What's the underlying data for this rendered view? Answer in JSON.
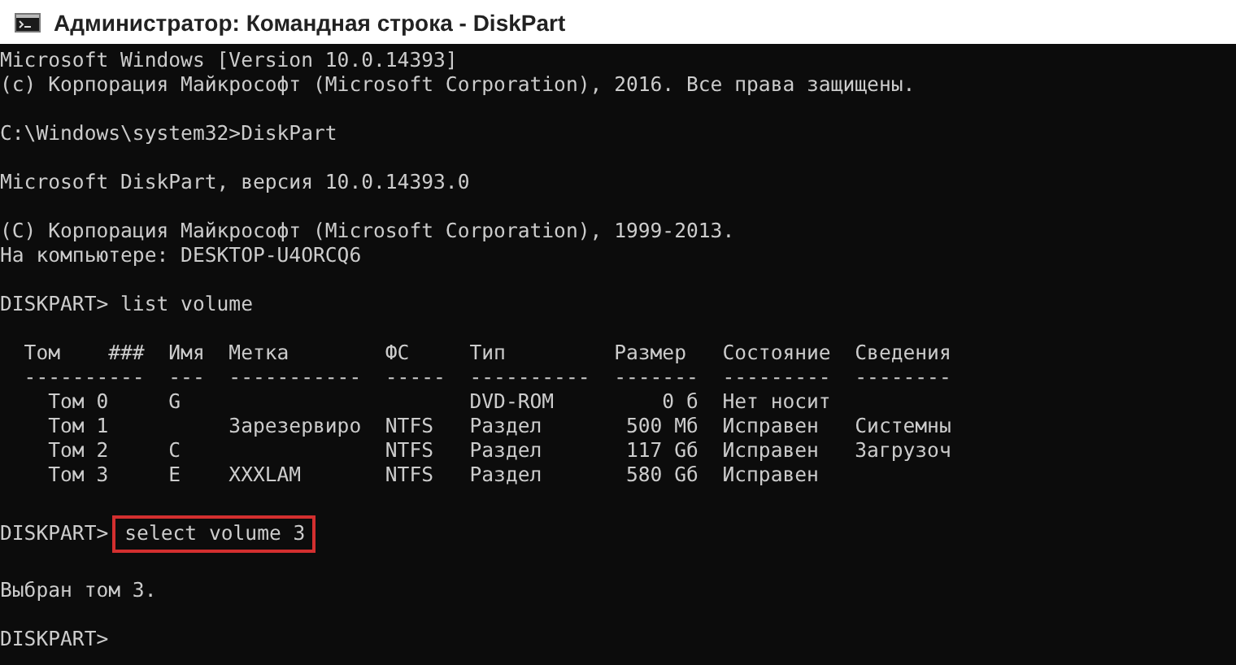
{
  "window": {
    "title": "Администратор: Командная строка - DiskPart"
  },
  "console": {
    "lines": [
      {
        "kind": "output",
        "text": "Microsoft Windows [Version 10.0.14393]"
      },
      {
        "kind": "output",
        "text": "(c) Корпорация Майкрософт (Microsoft Corporation), 2016. Все права защищены."
      },
      {
        "kind": "blank"
      },
      {
        "kind": "output",
        "text": "C:\\Windows\\system32>DiskPart"
      },
      {
        "kind": "blank"
      },
      {
        "kind": "output",
        "text": "Microsoft DiskPart, версия 10.0.14393.0"
      },
      {
        "kind": "blank"
      },
      {
        "kind": "output",
        "text": "(C) Корпорация Майкрософт (Microsoft Corporation), 1999-2013."
      },
      {
        "kind": "output",
        "text": "На компьютере: DESKTOP-U4ORCQ6"
      },
      {
        "kind": "blank"
      },
      {
        "kind": "output",
        "text": "DISKPART> list volume"
      },
      {
        "kind": "blank"
      },
      {
        "kind": "output",
        "text": "  Том    ###  Имя  Метка        ФС     Тип         Размер   Состояние  Сведения"
      },
      {
        "kind": "output",
        "text": "  ----------  ---  -----------  -----  ----------  -------  ---------  --------"
      },
      {
        "kind": "output",
        "text": "    Том 0     G                        DVD-ROM         0 б  Нет носит"
      },
      {
        "kind": "output",
        "text": "    Том 1          Зарезервиро  NTFS   Раздел       500 Мб  Исправен   Системны"
      },
      {
        "kind": "output",
        "text": "    Том 2     C                 NTFS   Раздел       117 Gб  Исправен   Загрузоч"
      },
      {
        "kind": "output",
        "text": "    Том 3     E    XXXLAM       NTFS   Раздел       580 Gб  Исправен"
      },
      {
        "kind": "blank"
      },
      {
        "kind": "command",
        "prompt": "DISKPART>",
        "command": "select volume 3",
        "highlighted": true
      },
      {
        "kind": "blank"
      },
      {
        "kind": "output",
        "text": "Выбран том 3."
      },
      {
        "kind": "blank"
      },
      {
        "kind": "output",
        "text": "DISKPART>"
      }
    ]
  }
}
